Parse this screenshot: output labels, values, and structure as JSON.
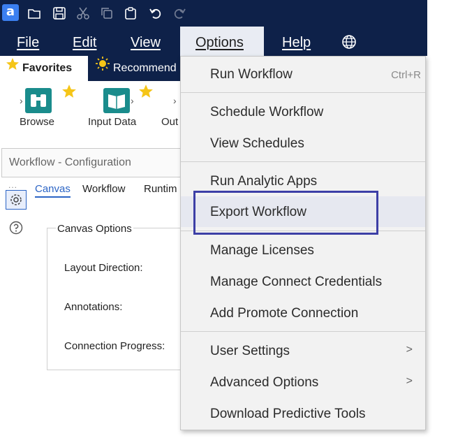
{
  "titlebar": {
    "app_letter": "a",
    "icons": [
      "open-folder-icon",
      "save-icon",
      "cut-icon",
      "copy-icon",
      "paste-icon",
      "undo-icon",
      "redo-icon"
    ]
  },
  "menubar": {
    "items": [
      {
        "label": "File",
        "ul": "F"
      },
      {
        "label": "Edit",
        "ul": "E"
      },
      {
        "label": "View",
        "ul": "V"
      },
      {
        "label": "Options",
        "ul": "O"
      },
      {
        "label": "Help",
        "ul": "H"
      }
    ],
    "globe_icon": "globe-icon"
  },
  "ribbon": {
    "tabs": [
      {
        "label": "Favorites",
        "icon": "star-icon"
      },
      {
        "label": "Recommend",
        "icon": "lightbulb-icon"
      }
    ],
    "tools": [
      {
        "label": "Browse",
        "icon": "binoculars-icon"
      },
      {
        "label": "Input Data",
        "icon": "book-icon"
      },
      {
        "label": "Out",
        "icon": "output-icon"
      }
    ]
  },
  "config": {
    "title": "Workflow - Configuration",
    "dots": "...",
    "subtabs": [
      "Canvas",
      "Workflow",
      "Runtim"
    ],
    "section_title": "Canvas Options",
    "labels": [
      "Layout Direction:",
      "Annotations:",
      "Connection Progress:"
    ]
  },
  "options_menu": {
    "run_workflow": "Run Workflow",
    "run_workflow_shortcut": "Ctrl+R",
    "schedule_workflow": "Schedule Workflow",
    "view_schedules": "View Schedules",
    "run_analytic_apps": "Run Analytic Apps",
    "export_workflow": "Export Workflow",
    "manage_licenses": "Manage Licenses",
    "manage_connect_credentials": "Manage Connect Credentials",
    "add_promote_connection": "Add Promote Connection",
    "user_settings": "User Settings",
    "advanced_options": "Advanced Options",
    "download_predictive_tools": "Download Predictive Tools",
    "submenu_arrow": ">"
  },
  "colors": {
    "navy": "#0e2149",
    "highlight_border": "#3d3fa6",
    "accent_blue": "#2b64c5",
    "tool_teal": "#1a8c8c",
    "star_yellow": "#f5c518"
  }
}
